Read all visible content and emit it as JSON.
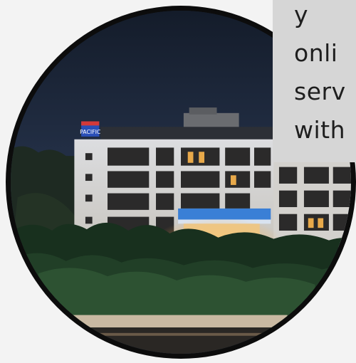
{
  "hero_image": {
    "signage_text": "PACIFIC",
    "colors": {
      "frame": "#0c0c0c",
      "sky": "#1c2738",
      "card_bg": "#d6d6d6",
      "text": "#1e1e1e"
    }
  },
  "text_card": {
    "lines": [
      "y",
      "onli",
      "serv",
      "with"
    ]
  }
}
